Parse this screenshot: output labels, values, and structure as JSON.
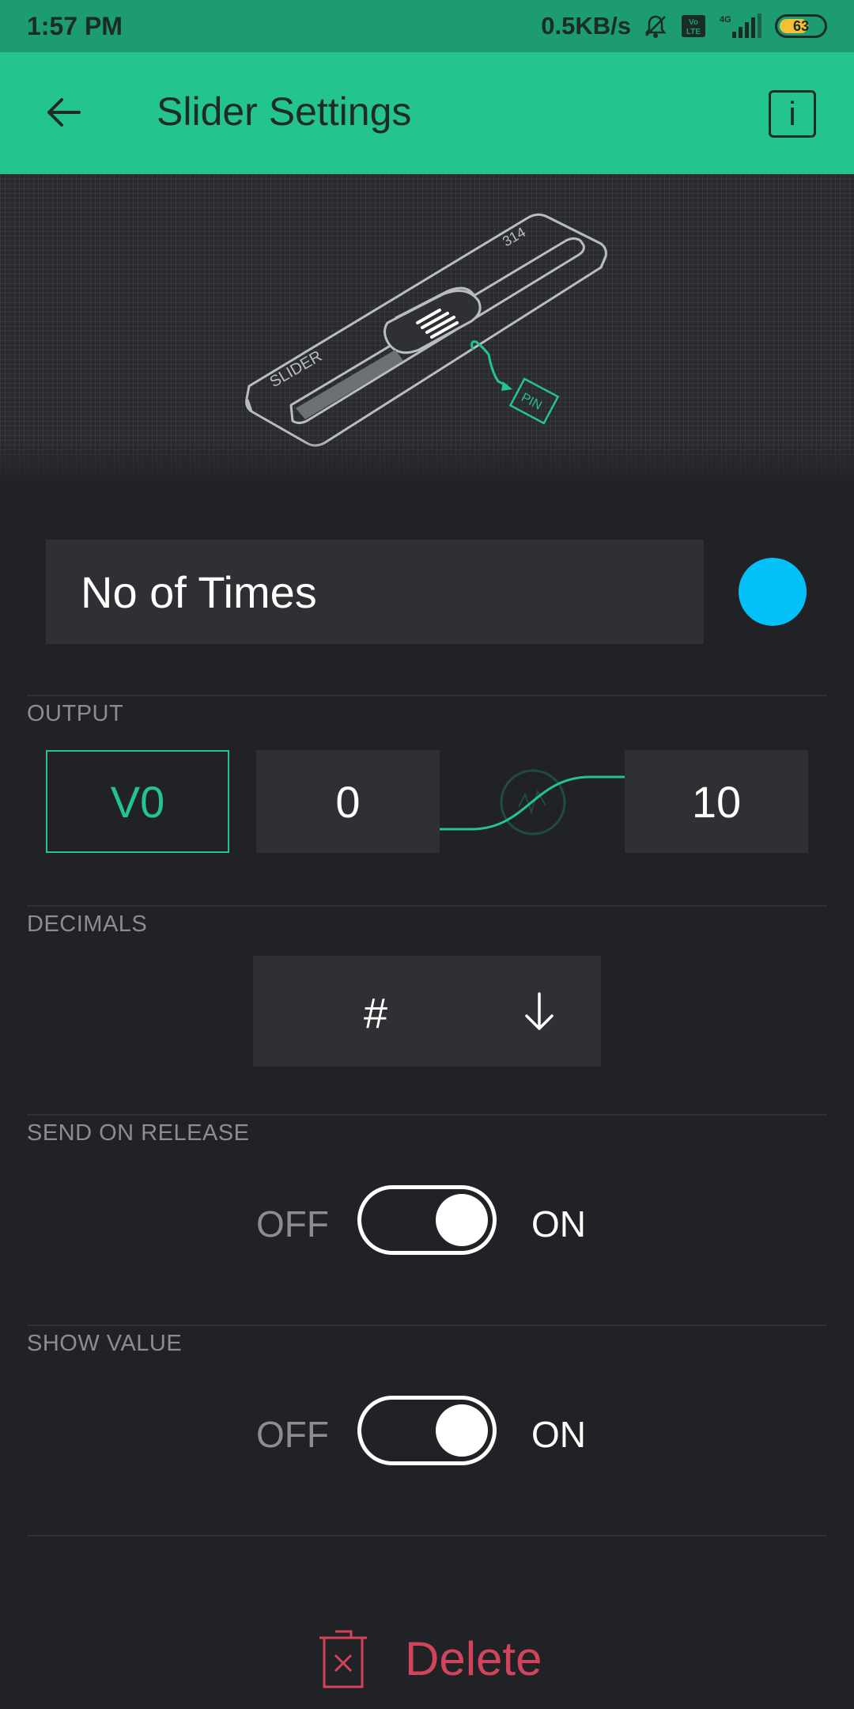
{
  "status_bar": {
    "time": "1:57 PM",
    "network_speed": "0.5KB/s",
    "icons": [
      "mute-icon",
      "volte-icon",
      "signal-4g-icon"
    ],
    "battery_level": "63"
  },
  "app_bar": {
    "title": "Slider Settings",
    "back_icon": "arrow-left-icon",
    "info_label": "i"
  },
  "hero": {
    "widget_label": "SLIDER",
    "value_label": "314",
    "pin_label": "PIN"
  },
  "widget_name": {
    "value": "No of Times",
    "color": "#04c0f8"
  },
  "output": {
    "label": "OUTPUT",
    "pin": "V0",
    "min": "0",
    "max": "10"
  },
  "decimals": {
    "label": "DECIMALS",
    "value": "#"
  },
  "send_on_release": {
    "label": "SEND ON RELEASE",
    "off_label": "OFF",
    "on_label": "ON",
    "state": "on"
  },
  "show_value": {
    "label": "SHOW VALUE",
    "off_label": "OFF",
    "on_label": "ON",
    "state": "on"
  },
  "delete": {
    "label": "Delete"
  },
  "colors": {
    "accent": "#23c48e",
    "danger": "#d3435c",
    "background": "#212226"
  }
}
